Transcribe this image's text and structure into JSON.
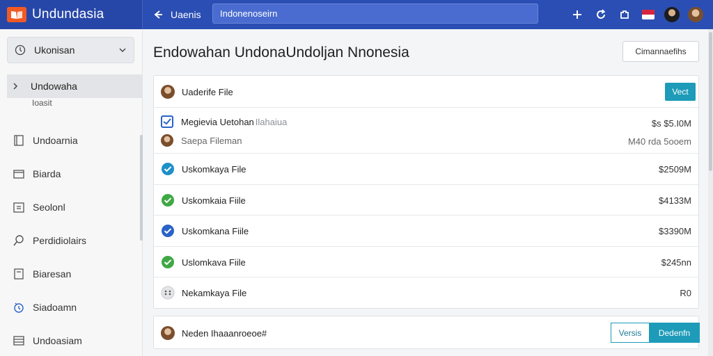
{
  "app": {
    "title": "Undundasia"
  },
  "topbar": {
    "back_label": "Uaenis",
    "search_value": "Indonenoseirn",
    "icons": [
      "plus-icon",
      "refresh-icon",
      "puzzle-icon",
      "flag-icon",
      "user-avatar",
      "profile-avatar"
    ]
  },
  "sidebar": {
    "workspace": "Ukonisan",
    "active": {
      "label": "Undowaha",
      "sub": "Ioasit"
    },
    "items": [
      {
        "label": "Undoarnia",
        "icon": "document-icon"
      },
      {
        "label": "Biarda",
        "icon": "folder-icon"
      },
      {
        "label": "Seolonl",
        "icon": "calendar-icon"
      },
      {
        "label": "Perdidiolairs",
        "icon": "search-icon"
      },
      {
        "label": "Biaresan",
        "icon": "file-icon"
      },
      {
        "label": "Siadoamn",
        "icon": "clock-icon"
      },
      {
        "label": "Undoasiam",
        "icon": "grid-icon"
      }
    ]
  },
  "main": {
    "title": "Endowahan UndonaUndoljan Nnonesia",
    "manage_label": "Cimannaefihs",
    "header_row": {
      "label": "Uaderife File",
      "button": "Vect"
    },
    "media_row": {
      "title": "Megievia Uetohan",
      "title_muted": "Ilahaiua",
      "amount": "$s $5.I0M",
      "sub": "Saepa Fileman",
      "sub_right": "M40 rda 5ooem"
    },
    "files": [
      {
        "label": "Uskomkaya File",
        "amount": "$2509M",
        "status": "teal"
      },
      {
        "label": "Uskomkaia Fiile",
        "amount": "$4133M",
        "status": "green"
      },
      {
        "label": "Uskomkana Fiile",
        "amount": "$3390M",
        "status": "blue"
      },
      {
        "label": "Uslomkava Fiile",
        "amount": "$245nn",
        "status": "green"
      },
      {
        "label": "Nekamkaya File",
        "amount": "R0",
        "status": "pending"
      }
    ],
    "footer": {
      "label": "Neden Ihaaan",
      "label_accent": "roeoe#",
      "outline_btn": "Versis",
      "solid_btn": "Dedenfn"
    }
  },
  "colors": {
    "topbar": "#2a4eb3",
    "accent": "#1d9bb8",
    "green": "#3fa845",
    "blue": "#2a63c8",
    "brand": "#f15a24"
  }
}
